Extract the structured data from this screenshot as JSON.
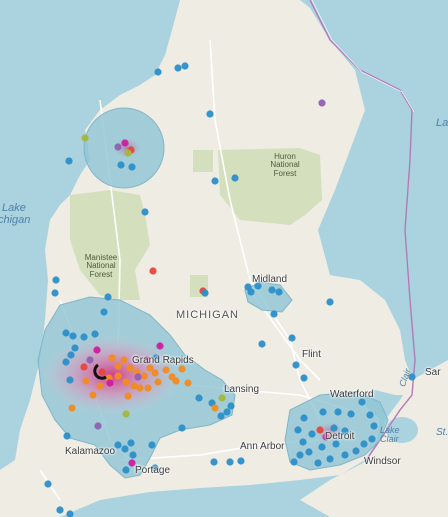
{
  "map": {
    "water_labels": {
      "lake_michigan_line1": "Lake",
      "lake_michigan_line2": "chigan",
      "lake_huron_fragment": "Lake",
      "lake_st_clair_line1": "Lake",
      "lake_st_clair_line2": "Clair",
      "st_clair_river": "Clair",
      "st_clair_r": "St."
    },
    "region_label": "MICHIGAN",
    "forests": {
      "huron_line1": "Huron",
      "huron_line2": "National",
      "huron_line3": "Forest",
      "manistee_line1": "Manistee",
      "manistee_line2": "National",
      "manistee_line3": "Forest"
    },
    "cities": {
      "midland": "Midland",
      "grand_rapids": "Grand Rapids",
      "lansing": "Lansing",
      "flint": "Flint",
      "waterford": "Waterford",
      "detroit": "Detroit",
      "ann_arbor": "Ann Arbor",
      "windsor": "Windsor",
      "kalamazoo": "Kalamazoo",
      "portage": "Portage",
      "sarnia": "Sar"
    },
    "colors": {
      "water": "#aad3df",
      "land": "#eeece3",
      "forest": "#d4e0bd",
      "cluster_fill": "#8ec5d5",
      "point_blue": "#2c8ec9",
      "point_orange": "#f28b22",
      "point_red": "#e8463c",
      "point_purple": "#8e62b1",
      "point_magenta": "#d11b9e",
      "point_olive": "#a8b63a",
      "heat_core": "#d9287f",
      "border": "#b47ab8"
    }
  }
}
